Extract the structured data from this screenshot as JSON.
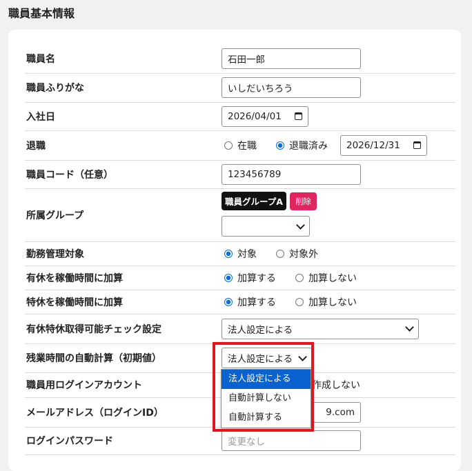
{
  "page_title": "職員基本情報",
  "rows": {
    "name": {
      "label": "職員名",
      "value": "石田一郎"
    },
    "kana": {
      "label": "職員ふりがな",
      "value": "いしだいちろう"
    },
    "hire_date": {
      "label": "入社日",
      "value": "2026/04/01"
    },
    "retirement": {
      "label": "退職",
      "opt1": "在職",
      "opt2": "退職済み",
      "selected": "退職済み",
      "date": "2026/12/31"
    },
    "code": {
      "label": "職員コード（任意）",
      "value": "123456789"
    },
    "group": {
      "label": "所属グループ",
      "tag": "職員グループA",
      "delete": "削除",
      "select_value": ""
    },
    "attendance": {
      "label": "勤務管理対象",
      "opt1": "対象",
      "opt2": "対象外",
      "selected": "対象"
    },
    "paid_leave": {
      "label": "有休を稼働時間に加算",
      "opt1": "加算する",
      "opt2": "加算しない",
      "selected": "加算する"
    },
    "special_leave": {
      "label": "特休を稼働時間に加算",
      "opt1": "加算する",
      "opt2": "加算しない",
      "selected": "加算する"
    },
    "leave_check": {
      "label": "有休特休取得可能チェック設定",
      "value": "法人設定による"
    },
    "overtime": {
      "label": "残業時間の自動計算（初期値）",
      "value": "法人設定による"
    },
    "login_account": {
      "label": "職員用ログインアカウント",
      "visible_text": "作成しない"
    },
    "email": {
      "label": "メールアドレス（ログインID）",
      "visible_value": "9.com"
    },
    "password": {
      "label": "ログインパスワード",
      "placeholder": "変更なし"
    }
  },
  "dropdown": {
    "options": [
      "法人設定による",
      "自動計算しない",
      "自動計算する"
    ],
    "selected_index": 0
  },
  "colors": {
    "accent": "#0a6ed8",
    "delete": "#e0245e",
    "highlight": "#e8141b"
  }
}
